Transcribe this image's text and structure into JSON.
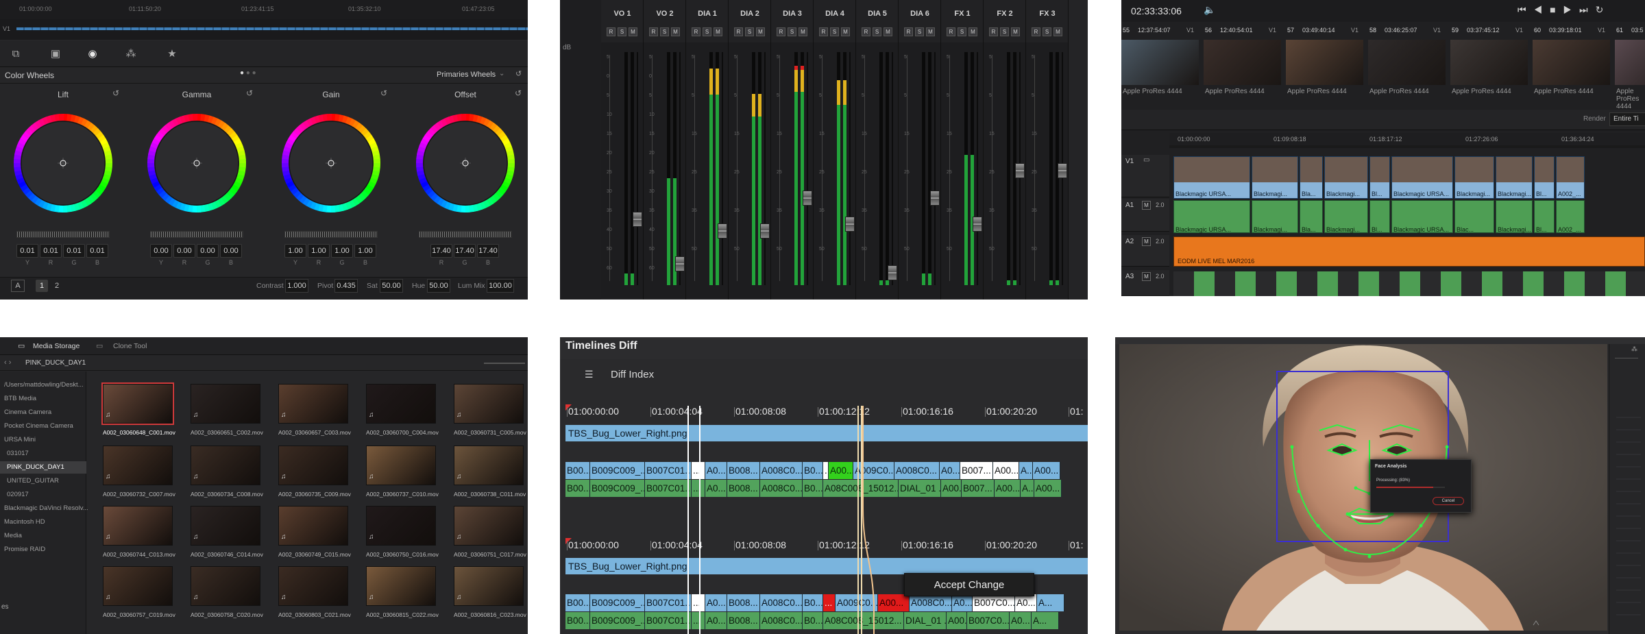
{
  "color_page": {
    "timecodes": [
      "01:00:00:00",
      "01:11:50:20",
      "01:23:41:15",
      "01:35:32:10",
      "01:47:23:05"
    ],
    "track_label": "V1",
    "panel_title": "Color Wheels",
    "mode": "Primaries Wheels",
    "wheels": [
      {
        "name": "Lift",
        "values": [
          "0.01",
          "0.01",
          "0.01",
          "0.01"
        ]
      },
      {
        "name": "Gamma",
        "values": [
          "0.00",
          "0.00",
          "0.00",
          "0.00"
        ]
      },
      {
        "name": "Gain",
        "values": [
          "1.00",
          "1.00",
          "1.00",
          "1.00"
        ]
      },
      {
        "name": "Offset",
        "values": [
          "17.40",
          "17.40",
          "17.40"
        ]
      }
    ],
    "channel_letters": [
      "Y",
      "R",
      "G",
      "B"
    ],
    "page_buttons": [
      "A",
      "1",
      "2"
    ],
    "bottom": {
      "contrast_label": "Contrast",
      "contrast": "1.000",
      "pivot_label": "Pivot",
      "pivot": "0.435",
      "sat_label": "Sat",
      "sat": "50.00",
      "hue_label": "Hue",
      "hue": "50.00",
      "lummix_label": "Lum Mix",
      "lummix": "100.00"
    }
  },
  "mixer": {
    "db_label": "dB",
    "channels": [
      "VO 1",
      "VO 2",
      "DIA 1",
      "DIA 2",
      "DIA 3",
      "DIA 4",
      "DIA 5",
      "DIA 6",
      "FX 1",
      "FX 2",
      "FX 3"
    ],
    "rsm": [
      "R",
      "S",
      "M"
    ],
    "levels": [
      0.05,
      0.46,
      0.93,
      0.82,
      0.94,
      0.88,
      0.02,
      0.05,
      0.56,
      0.02,
      0.02
    ],
    "faders": [
      0.25,
      0.06,
      0.2,
      0.2,
      0.34,
      0.23,
      0.02,
      0.34,
      0.23,
      0.46,
      0.46
    ],
    "scale": [
      "5",
      "0",
      "5",
      "10",
      "15",
      "20",
      "25",
      "30",
      "35",
      "40",
      "50",
      "60"
    ]
  },
  "edit": {
    "timecode": "02:33:33:06",
    "clips_header": [
      {
        "num": "55",
        "tc": "12:37:54:07",
        "track": "V1"
      },
      {
        "num": "56",
        "tc": "12:40:54:01",
        "track": "V1"
      },
      {
        "num": "57",
        "tc": "03:49:40:14",
        "track": "V1"
      },
      {
        "num": "58",
        "tc": "03:46:25:07",
        "track": "V1"
      },
      {
        "num": "59",
        "tc": "03:37:45:12",
        "track": "V1"
      },
      {
        "num": "60",
        "tc": "03:39:18:01",
        "track": "V1"
      },
      {
        "num": "61",
        "tc": "03:5",
        "track": ""
      }
    ],
    "codec": "Apple ProRes 4444",
    "render_label": "Render",
    "render_value": "Entire Ti",
    "ruler": [
      "01:00:00:00",
      "01:09:08:18",
      "01:18:17:12",
      "01:27:26:06",
      "01:36:34:24"
    ],
    "tracks": [
      "V1",
      "A1",
      "A2",
      "A3"
    ],
    "video_clip_names": [
      "Blackmagic URSA...",
      "Blackmagi...",
      "Bla...",
      "Blackmagi...",
      "Bl...",
      "Blackmagic URSA...",
      "Blackmagi...",
      "Blackmagi...",
      "Bl...",
      "A002_..."
    ],
    "audio_clip_names": [
      "Blackmagic URSA...",
      "Blackmagi...",
      "Bla...",
      "Blackmagi...",
      "Bl...",
      "Blackmagic URSA...",
      "Blac...",
      "Blackmagi...",
      "Bl...",
      "A002_..."
    ],
    "music_clip": "EODM LIVE MEL MAR2016",
    "a_gain": "2.0"
  },
  "media": {
    "tabs": [
      "Media Storage",
      "Clone Tool"
    ],
    "folder": "PINK_DUCK_DAY1",
    "sidebar": [
      "/Users/mattdowling/Deskt...",
      "BTB Media",
      "Cinema Camera",
      "Pocket Cinema Camera",
      "URSA Mini",
      "031017",
      "PINK_DUCK_DAY1",
      "UNITED_GUITAR",
      "020917",
      "Blackmagic DaVinci Resolv...",
      "Macintosh HD",
      "Media",
      "Promise RAID"
    ],
    "footer": "es",
    "clips": [
      "A002_03060648_C001.mov",
      "A002_03060651_C002.mov",
      "A002_03060657_C003.mov",
      "A002_03060700_C004.mov",
      "A002_03060731_C005.mov",
      "A002_03060732_C007.mov",
      "A002_03060734_C008.mov",
      "A002_03060735_C009.mov",
      "A002_03060737_C010.mov",
      "A002_03060738_C011.mov",
      "A002_03060744_C013.mov",
      "A002_03060746_C014.mov",
      "A002_03060749_C015.mov",
      "A002_03060750_C016.mov",
      "A002_03060751_C017.mov",
      "A002_03060757_C019.mov",
      "A002_03060758_C020.mov",
      "A002_03060803_C021.mov",
      "A002_03060815_C022.mov",
      "A002_03060816_C023.mov"
    ]
  },
  "diff": {
    "title": "Timelines Diff",
    "index_label": "Diff Index",
    "ruler": [
      "01:00:00:00",
      "01:00:04:04",
      "01:00:08:08",
      "01:00:12:12",
      "01:00:16:16",
      "01:00:20:20",
      "01:"
    ],
    "bug_clip": "TBS_Bug_Lower_Right.png",
    "top_video": [
      "B00...",
      "B009C009_...",
      "B007C01...",
      "...",
      "A0...",
      "B008...",
      "A008C0...",
      "B0...",
      "...",
      "A00...",
      "A009C0...",
      "A008C0...",
      "A0...",
      "B007...",
      "A00...",
      "A...",
      "A00..."
    ],
    "top_audio": [
      "B00...",
      "B009C009_...",
      "B007C01...",
      "...",
      "A0...",
      "B008...",
      "A008C0...",
      "B0...",
      "A08C008_15012...",
      "DIAL_01 ...",
      "A00...",
      "B007...",
      "A00...",
      "A...",
      "A00..."
    ],
    "bottom_video": [
      "B00...",
      "B009C009_...",
      "B007C01...",
      "...",
      "A0...",
      "B008...",
      "A008C0...",
      "B0...",
      "...",
      "A009C0...",
      "A00...",
      "A008C0...",
      "A0...",
      "B007C0...",
      "A0...",
      "A..."
    ],
    "bottom_audio": [
      "B00...",
      "B009C009_...",
      "B007C01...",
      "...",
      "A0...",
      "B008...",
      "A008C0...",
      "B0...",
      "A08C008_15012...",
      "DIAL_01 ...",
      "A00...",
      "B007C0...",
      "A0...",
      "A..."
    ],
    "accept_label": "Accept Change"
  },
  "face": {
    "dialog_title": "Face Analysis",
    "processing": "Processing: (83%)",
    "cancel": "Cancel"
  },
  "colors": {
    "green_meter": "#22a33a",
    "clip_blue": "#7ab4dd",
    "clip_green": "#52a35c",
    "changed_green": "#33d11c",
    "changed_red": "#e01a1a",
    "music_orange": "#e8771d",
    "face_mesh": "#2ef045",
    "face_box": "#3b2fd1"
  }
}
